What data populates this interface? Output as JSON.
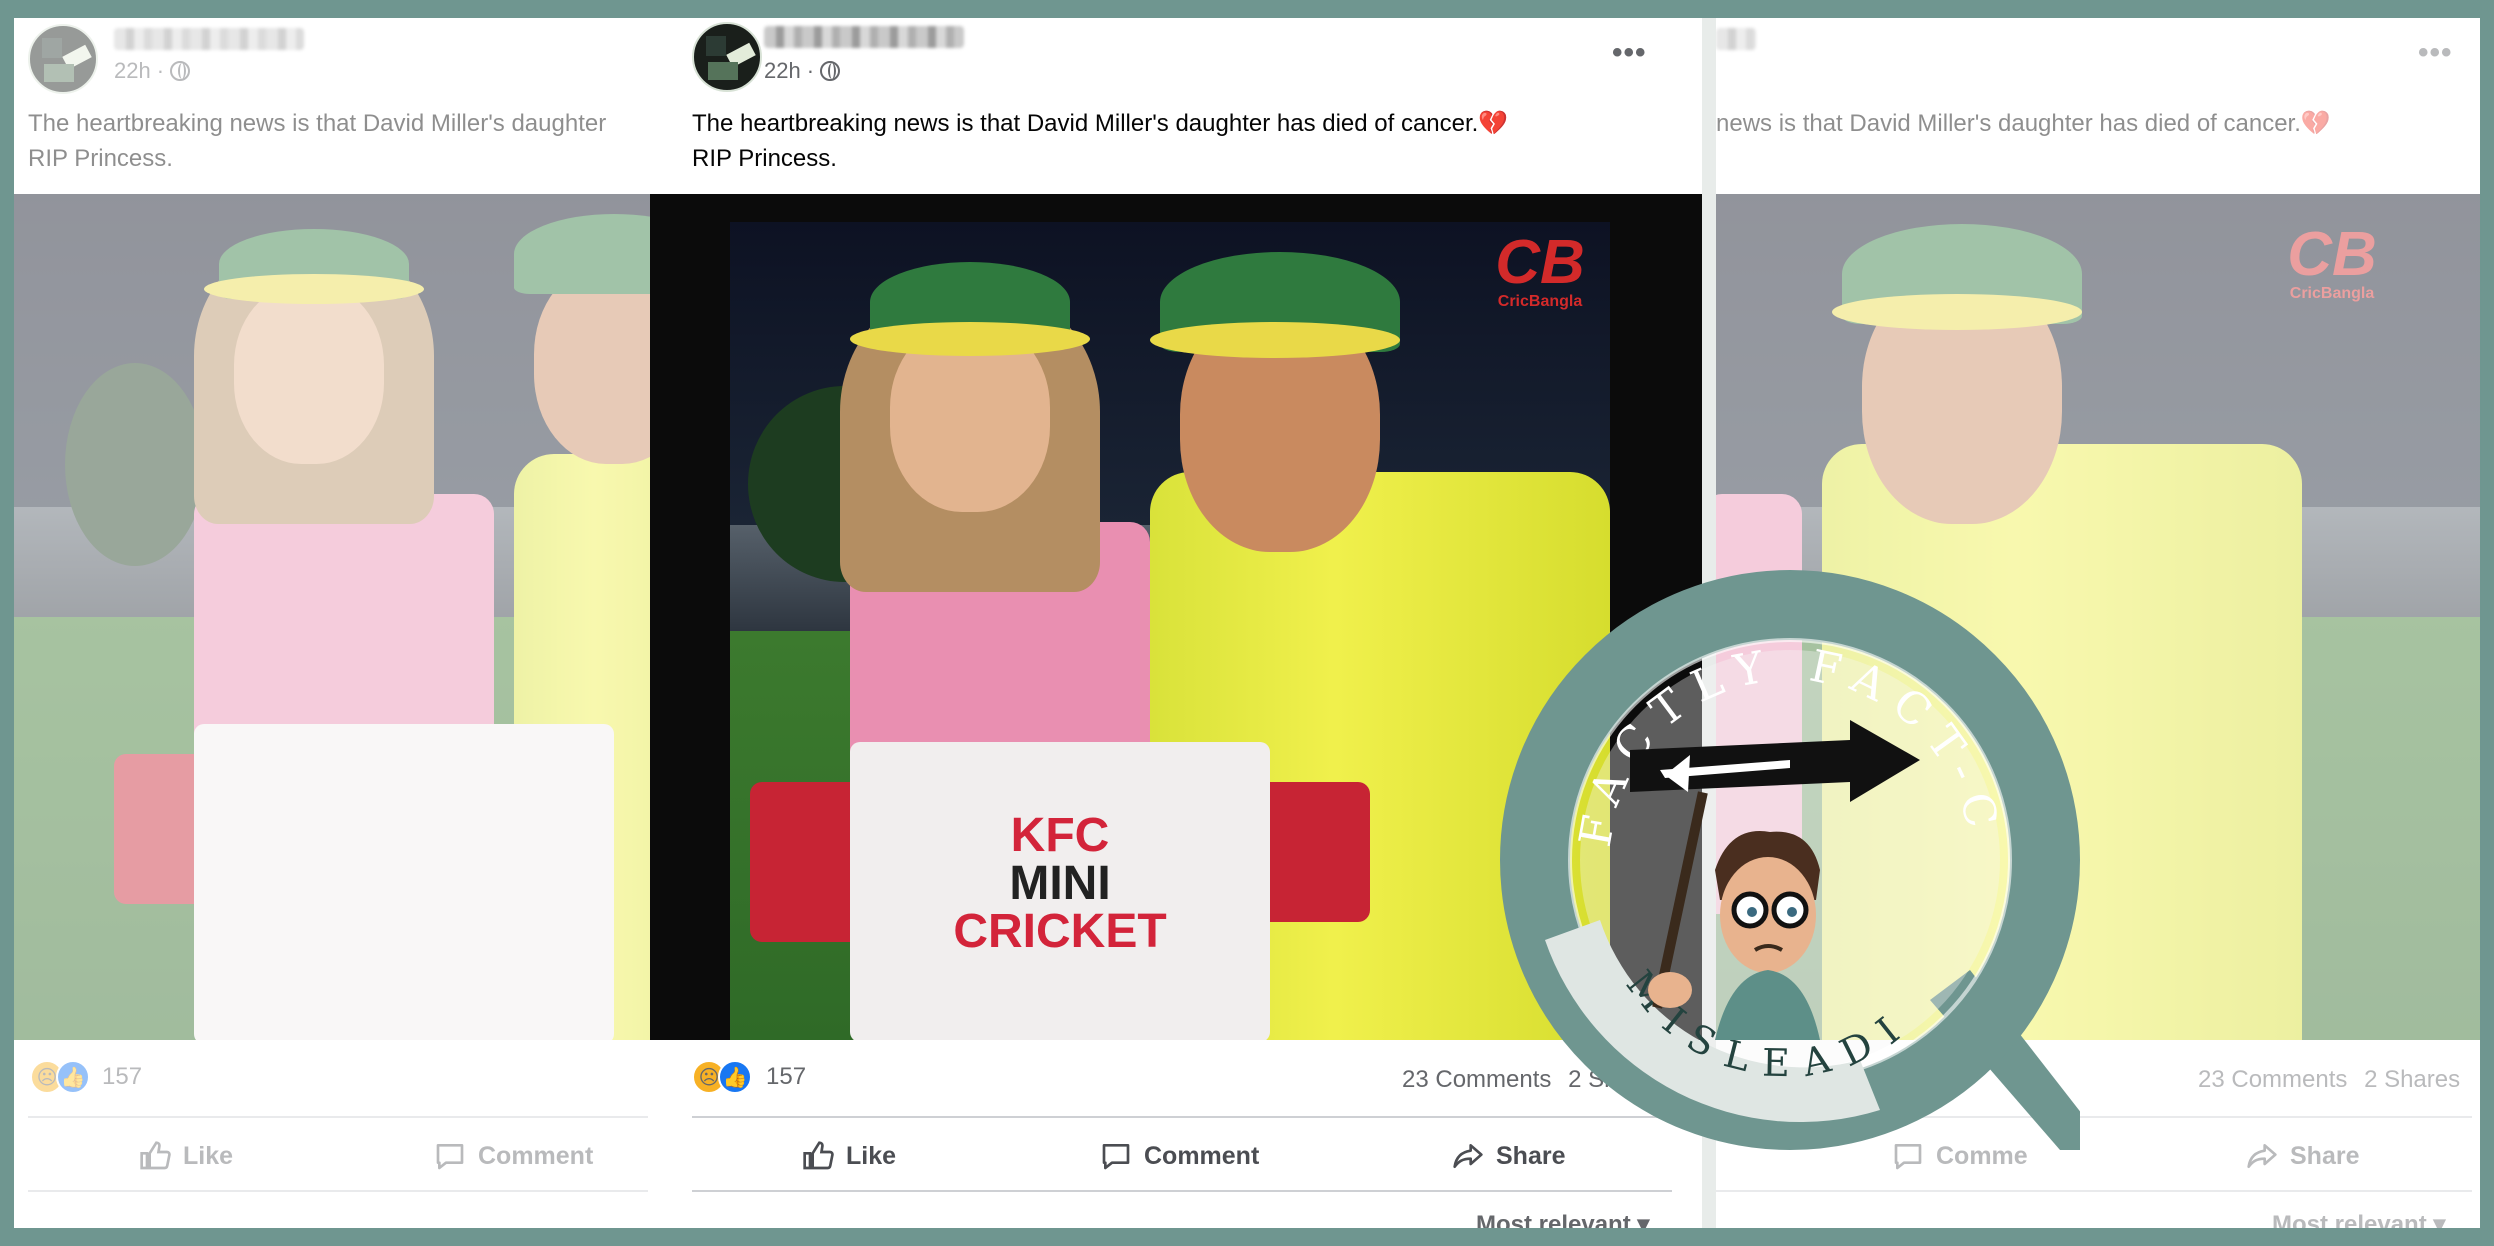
{
  "post": {
    "time": "22h",
    "text_line1": "The heartbreaking news is that David Miller's daughter has died of cancer.",
    "text_line2": "RIP Princess.",
    "heart_emoji": "💔",
    "more_label": "•••",
    "reaction_count": "157",
    "comments": "23 Comments",
    "shares": "2 Shares",
    "shares_truncated": "2 Sh",
    "actions": {
      "like": "Like",
      "comment": "Comment",
      "share": "Share"
    },
    "sort": "Most relevant",
    "sort_icon": "▾"
  },
  "left_ghost": {
    "text_line1": "The heartbreaking news is that David Miller's daughter",
    "text_line2": "RIP Princess."
  },
  "right_ghost": {
    "text_line1": "news is that David Miller's daughter has died of cancer.",
    "comment_partial": "Comme"
  },
  "photo": {
    "watermark": "CB",
    "watermark_sub": "CricBangla",
    "shirt_kfc": "KFC",
    "shirt_mini": "MINI",
    "shirt_cricket": "CRICKET"
  },
  "badge": {
    "arc_text": "FACTLY FACT-CHECK",
    "verdict": "MISLEADING"
  },
  "colors": {
    "frame": "#6f9690",
    "badge_ring": "#6f9690",
    "facebook_blue": "#1877f2",
    "heart_red": "#d0293f"
  }
}
